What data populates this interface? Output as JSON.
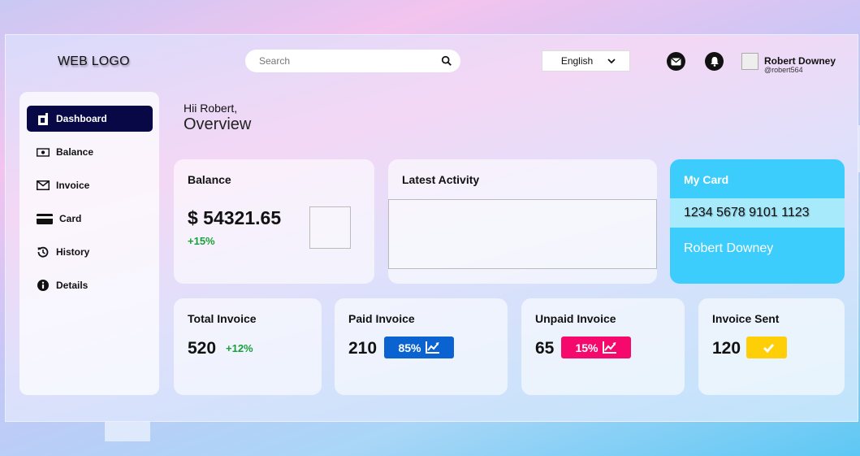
{
  "header": {
    "logo": "WEB LOGO",
    "search_placeholder": "Search",
    "language": "English",
    "user_name": "Robert Downey",
    "user_handle": "@robert564"
  },
  "sidebar": {
    "items": [
      {
        "label": "Dashboard",
        "icon": "dashboard-icon",
        "active": true
      },
      {
        "label": "Balance",
        "icon": "money-bill-icon"
      },
      {
        "label": "Invoice",
        "icon": "envelope-icon"
      },
      {
        "label": "Card",
        "icon": "credit-card-icon"
      },
      {
        "label": "History",
        "icon": "history-icon"
      },
      {
        "label": "Details",
        "icon": "info-icon"
      }
    ]
  },
  "main": {
    "greeting": "Hii Robert,",
    "title": "Overview"
  },
  "balance": {
    "title": "Balance",
    "amount": "$ 54321.65",
    "change": "+15%"
  },
  "activity": {
    "title": "Latest Activity"
  },
  "mycard": {
    "title": "My Card",
    "number": "1234 5678 9101 1123",
    "holder": "Robert Downey"
  },
  "invoices": {
    "total": {
      "title": "Total Invoice",
      "value": "520",
      "change": "+12%"
    },
    "paid": {
      "title": "Paid Invoice",
      "value": "210",
      "badge": "85%",
      "color": "#0a63d1"
    },
    "unpaid": {
      "title": "Unpaid Invoice",
      "value": "65",
      "badge": "15%",
      "color": "#f6096d"
    },
    "sent": {
      "title": "Invoice Sent",
      "value": "120",
      "color": "#fecf06"
    }
  },
  "colors": {
    "nav_active": "#070845",
    "card_accent": "#3ccdfd",
    "positive": "#1aa038"
  }
}
